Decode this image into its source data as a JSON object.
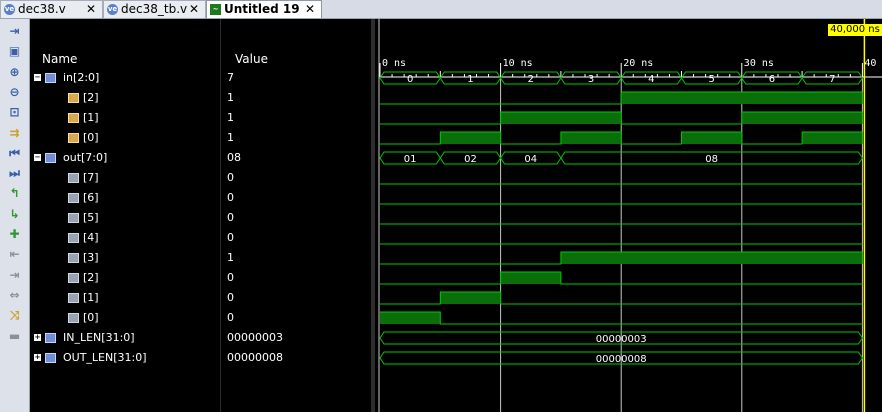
{
  "tabs": [
    {
      "label": "dec38.v",
      "icon": "verilog-icon",
      "active": false
    },
    {
      "label": "dec38_tb.v",
      "icon": "verilog-icon",
      "active": false
    },
    {
      "label": "Untitled 19",
      "icon": "waveform-icon",
      "active": true
    }
  ],
  "tab_close": "✕",
  "columns": {
    "name": "Name",
    "value": "Value"
  },
  "cursor_time": "40,000 ns",
  "time_axis": {
    "labels": [
      "0 ns",
      "10 ns",
      "20 ns",
      "30 ns",
      "40"
    ],
    "ticks": [
      0,
      10,
      20,
      30,
      40
    ]
  },
  "signals": [
    {
      "name": "in[2:0]",
      "value": "7",
      "kind": "bus",
      "level": 0,
      "expanded": true,
      "segments": [
        {
          "t0": 0,
          "t1": 5,
          "text": "0"
        },
        {
          "t0": 5,
          "t1": 10,
          "text": "1"
        },
        {
          "t0": 10,
          "t1": 15,
          "text": "2"
        },
        {
          "t0": 15,
          "t1": 20,
          "text": "3"
        },
        {
          "t0": 20,
          "t1": 25,
          "text": "4"
        },
        {
          "t0": 25,
          "t1": 30,
          "text": "5"
        },
        {
          "t0": 30,
          "t1": 35,
          "text": "6"
        },
        {
          "t0": 35,
          "t1": 40,
          "text": "7"
        }
      ]
    },
    {
      "name": "[2]",
      "value": "1",
      "kind": "bit",
      "level": 1,
      "icon": "sig",
      "highs": [
        [
          20,
          40
        ]
      ]
    },
    {
      "name": "[1]",
      "value": "1",
      "kind": "bit",
      "level": 1,
      "icon": "sig",
      "highs": [
        [
          10,
          20
        ],
        [
          30,
          40
        ]
      ]
    },
    {
      "name": "[0]",
      "value": "1",
      "kind": "bit",
      "level": 1,
      "icon": "sig",
      "highs": [
        [
          5,
          10
        ],
        [
          15,
          20
        ],
        [
          25,
          30
        ],
        [
          35,
          40
        ]
      ]
    },
    {
      "name": "out[7:0]",
      "value": "08",
      "kind": "bus",
      "level": 0,
      "expanded": true,
      "segments": [
        {
          "t0": 0,
          "t1": 5,
          "text": "01"
        },
        {
          "t0": 5,
          "t1": 10,
          "text": "02"
        },
        {
          "t0": 10,
          "t1": 15,
          "text": "04"
        },
        {
          "t0": 15,
          "t1": 40,
          "text": "08"
        }
      ]
    },
    {
      "name": "[7]",
      "value": "0",
      "kind": "bit",
      "level": 1,
      "icon": "sig2",
      "highs": []
    },
    {
      "name": "[6]",
      "value": "0",
      "kind": "bit",
      "level": 1,
      "icon": "sig2",
      "highs": []
    },
    {
      "name": "[5]",
      "value": "0",
      "kind": "bit",
      "level": 1,
      "icon": "sig2",
      "highs": []
    },
    {
      "name": "[4]",
      "value": "0",
      "kind": "bit",
      "level": 1,
      "icon": "sig2",
      "highs": []
    },
    {
      "name": "[3]",
      "value": "1",
      "kind": "bit",
      "level": 1,
      "icon": "sig2",
      "highs": [
        [
          15,
          40
        ]
      ]
    },
    {
      "name": "[2]",
      "value": "0",
      "kind": "bit",
      "level": 1,
      "icon": "sig2",
      "highs": [
        [
          10,
          15
        ]
      ]
    },
    {
      "name": "[1]",
      "value": "0",
      "kind": "bit",
      "level": 1,
      "icon": "sig2",
      "highs": [
        [
          5,
          10
        ]
      ]
    },
    {
      "name": "[0]",
      "value": "0",
      "kind": "bit",
      "level": 1,
      "icon": "sig2",
      "highs": [
        [
          0,
          5
        ]
      ]
    },
    {
      "name": "IN_LEN[31:0]",
      "value": "00000003",
      "kind": "bus",
      "level": 0,
      "expanded": false,
      "segments": [
        {
          "t0": 0,
          "t1": 40,
          "text": "00000003"
        }
      ]
    },
    {
      "name": "OUT_LEN[31:0]",
      "value": "00000008",
      "kind": "bus",
      "level": 0,
      "expanded": false,
      "segments": [
        {
          "t0": 0,
          "t1": 40,
          "text": "00000008"
        }
      ]
    }
  ],
  "toolbar": [
    {
      "icon": "collapse-icon",
      "glyph": "⇥",
      "color": "#3a5fa8"
    },
    {
      "icon": "save-icon",
      "glyph": "▣",
      "color": "#3a5fa8"
    },
    {
      "icon": "zoom-in-icon",
      "glyph": "⊕",
      "color": "#3a5fa8"
    },
    {
      "icon": "zoom-out-icon",
      "glyph": "⊖",
      "color": "#3a5fa8"
    },
    {
      "icon": "zoom-fit-icon",
      "glyph": "⊡",
      "color": "#3a5fa8"
    },
    {
      "icon": "go-to-cursor-icon",
      "glyph": "⇉",
      "color": "#c9a02a"
    },
    {
      "icon": "go-to-start-icon",
      "glyph": "⏮",
      "color": "#3a5fa8"
    },
    {
      "icon": "go-to-end-icon",
      "glyph": "⏭",
      "color": "#3a5fa8"
    },
    {
      "icon": "previous-transition-icon",
      "glyph": "↰",
      "color": "#2e9a2e"
    },
    {
      "icon": "next-transition-icon",
      "glyph": "↳",
      "color": "#2e9a2e"
    },
    {
      "icon": "add-marker-icon",
      "glyph": "✚",
      "color": "#2e9a2e"
    },
    {
      "icon": "previous-marker-icon",
      "glyph": "⇤",
      "color": "#8a8f98"
    },
    {
      "icon": "next-marker-icon",
      "glyph": "⇥",
      "color": "#8a8f98"
    },
    {
      "icon": "swap-cursors-icon",
      "glyph": "⇔",
      "color": "#8a8f98"
    },
    {
      "icon": "snap-to-transition-icon",
      "glyph": "⤨",
      "color": "#c9a02a"
    },
    {
      "icon": "floating-ruler-icon",
      "glyph": "▬",
      "color": "#8a8f98"
    }
  ],
  "colors": {
    "wave": "#00c800",
    "wave_fill": "#0a6e0a",
    "cursor": "#ffff00",
    "axis": "#ffffff"
  }
}
